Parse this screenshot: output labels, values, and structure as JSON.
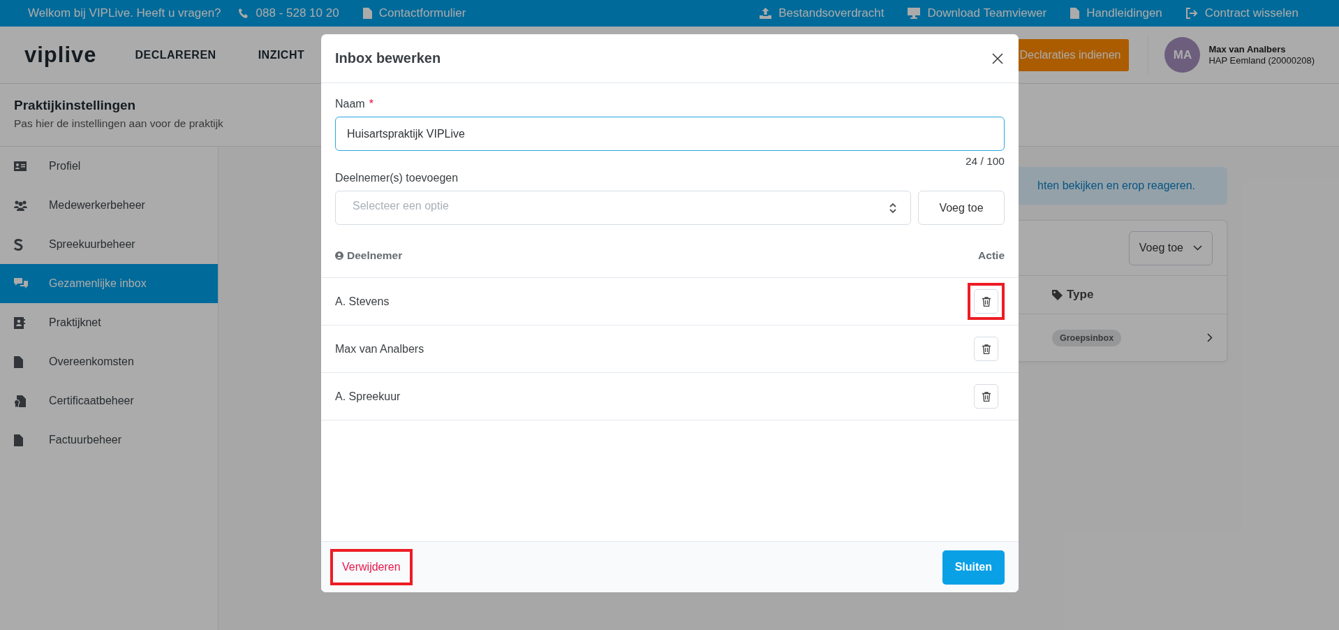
{
  "top_bar": {
    "welcome": "Welkom bij VIPLive. Heeft u vragen?",
    "left_links": [
      {
        "label": "088 - 528 10 20"
      },
      {
        "label": "Contactformulier"
      }
    ],
    "right_links": [
      {
        "label": "Bestandsoverdracht"
      },
      {
        "label": "Download Teamviewer"
      },
      {
        "label": "Handleidingen"
      },
      {
        "label": "Contract wisselen"
      }
    ]
  },
  "nav": {
    "logo": "viplive",
    "items": [
      "DECLAREREN",
      "INZICHT"
    ],
    "primary_button": "Declaraties indienen",
    "user": {
      "initials": "MA",
      "name": "Max van Analbers",
      "organization": "HAP Eemland (20000208)"
    }
  },
  "page": {
    "title": "Praktijkinstellingen",
    "subtitle": "Pas hier de instellingen aan voor de praktijk"
  },
  "sidebar": {
    "items": [
      {
        "label": "Profiel",
        "selected": false
      },
      {
        "label": "Medewerkerbeheer",
        "selected": false
      },
      {
        "label": "Spreekuurbeheer",
        "selected": false
      },
      {
        "label": "Gezamenlijke inbox",
        "selected": true
      },
      {
        "label": "Praktijknet",
        "selected": false
      },
      {
        "label": "Overeenkomsten",
        "selected": false
      },
      {
        "label": "Certificaatbeheer",
        "selected": false
      },
      {
        "label": "Factuurbeheer",
        "selected": false
      }
    ]
  },
  "content": {
    "alert": "hten bekijken en erop reageren.",
    "card": {
      "dropdown": "Voeg toe",
      "column": "Type",
      "rows": [
        {
          "badge": "Groepsinbox"
        }
      ]
    }
  },
  "modal": {
    "title": "Inbox bewerken",
    "name_field": {
      "label": "Naam",
      "required_mark": "*",
      "value": "Huisartspraktijk VIPLive",
      "counter": "24 / 100"
    },
    "participants_field": {
      "label": "Deelnemer(s) toevoegen",
      "placeholder": "Selecteer een optie",
      "button": "Voeg toe"
    },
    "table": {
      "columns": [
        "Deelnemer",
        "Actie"
      ],
      "rows": [
        {
          "name": "A. Stevens",
          "highlighted": true
        },
        {
          "name": "Max van Analbers",
          "highlighted": false
        },
        {
          "name": "A. Spreekuur",
          "highlighted": false
        }
      ]
    },
    "footer": {
      "delete_button": {
        "label": "Verwijderen",
        "highlighted": true
      },
      "close_button": "Sluiten"
    }
  }
}
